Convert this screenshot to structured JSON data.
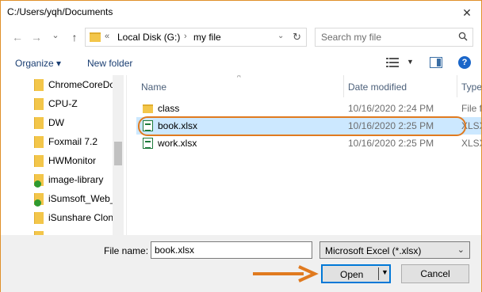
{
  "window": {
    "title": "C:/Users/yqh/Documents",
    "close": "✕"
  },
  "nav": {
    "back": "←",
    "forward": "→",
    "recent": "⌄",
    "up": "↑",
    "address_prefix": "«",
    "crumbs": [
      "Local Disk (G:)",
      "my file"
    ],
    "crumb_sep": "›",
    "address_dropdown": "⌄",
    "refresh": "↻",
    "search_placeholder": "Search my file"
  },
  "toolbar": {
    "organize_label": "Organize ▾",
    "new_folder_label": "New folder",
    "view_dropdown": "▼",
    "help_label": "?"
  },
  "tree": {
    "items": [
      {
        "label": "ChromeCoreDo",
        "lib": false
      },
      {
        "label": "CPU-Z",
        "lib": false
      },
      {
        "label": "DW",
        "lib": false
      },
      {
        "label": "Foxmail 7.2",
        "lib": false
      },
      {
        "label": "HWMonitor",
        "lib": false
      },
      {
        "label": "image-library",
        "lib": true
      },
      {
        "label": "iSumsoft_Web_",
        "lib": true
      },
      {
        "label": "iSunshare Clon",
        "lib": false
      }
    ]
  },
  "files": {
    "columns": {
      "name": "Name",
      "date": "Date modified",
      "type": "Type"
    },
    "sort_indicator": "^",
    "rows": [
      {
        "name": "class",
        "date": "10/16/2020 2:24 PM",
        "type": "File f",
        "kind": "folder",
        "selected": false
      },
      {
        "name": "book.xlsx",
        "date": "10/16/2020 2:25 PM",
        "type": "XLSX",
        "kind": "xlsx",
        "selected": true
      },
      {
        "name": "work.xlsx",
        "date": "10/16/2020 2:25 PM",
        "type": "XLSX",
        "kind": "xlsx",
        "selected": false
      }
    ]
  },
  "footer": {
    "file_name_label": "File name:",
    "file_name_value": "book.xlsx",
    "file_type_value": "Microsoft Excel (*.xlsx)",
    "type_dropdown": "⌄",
    "open_label": "Open",
    "open_dropdown": "▼",
    "cancel_label": "Cancel"
  },
  "colors": {
    "accent": "#0078d7",
    "selection": "#cce8ff",
    "highlight_annotation": "#e07a1f",
    "folder": "#f3c64a",
    "excel_green": "#1d7a3a"
  }
}
